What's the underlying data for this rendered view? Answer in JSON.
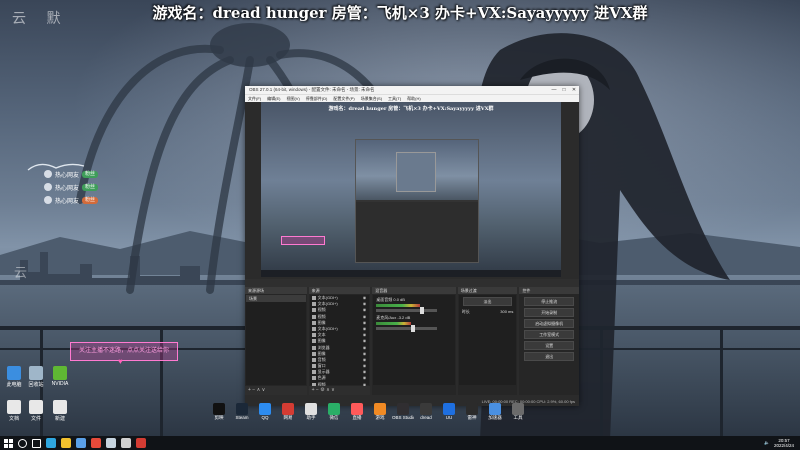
{
  "overlay": {
    "top_banner": "游戏名：dread hunger    房管：飞机×3    办卡+VX:Sayayyyyy 进VX群",
    "seal_text": "云 默",
    "seal_side": "云",
    "pink_subscribe": "关注主播不迷路，点点关注送给你",
    "chat": [
      {
        "name": "热心网友",
        "badge": "粉丝",
        "color": "#3f9e5a"
      },
      {
        "name": "热心网友",
        "badge": "粉丝",
        "color": "#3f9e5a"
      },
      {
        "name": "热心网友",
        "badge": "粉丝",
        "color": "#d36b3a"
      }
    ]
  },
  "desktop_icons": [
    {
      "label": "此电脑",
      "color": "#3b8ee0"
    },
    {
      "label": "回收站",
      "color": "#9fb6c9"
    },
    {
      "label": "NVIDIA",
      "color": "#5fb833"
    },
    {
      "label": "文档",
      "color": "#e8e8e8"
    },
    {
      "label": "文件",
      "color": "#e8e8e8"
    },
    {
      "label": "新建",
      "color": "#e8e8e8"
    }
  ],
  "obs": {
    "title": "OBS 27.0.1 (64-bit, windows) - 配置文件: 未命名 - 场景: 未命名",
    "menu": [
      "文件(F)",
      "编辑(E)",
      "视图(V)",
      "停靠部件(D)",
      "配置文件(P)",
      "场景集合(S)",
      "工具(T)",
      "帮助(H)"
    ],
    "preview_title": "游戏名：dread hunger   房管：飞机×3   办卡+VX:Sayayyyyy 进VX群",
    "window_controls": [
      "—",
      "□",
      "✕"
    ],
    "docks": {
      "scenes": {
        "header": "来源源场",
        "items": [
          "场景"
        ],
        "footer": "+ − ∧ ∨"
      },
      "sources": {
        "header": "来源",
        "items": [
          "文本(GDI+)",
          "文本(GDI+)",
          "视频",
          "视频",
          "图像",
          "文本(GDI+)",
          "文本",
          "图像",
          "浏览器",
          "图像",
          "音频",
          "窗口",
          "显示器",
          "色源",
          "视频"
        ],
        "footer": "+ − ⚙ ∧ ∨"
      },
      "mixer": {
        "header": "混音器",
        "channels": [
          {
            "name": "桌面音频 0.0 dB",
            "level": 0.72
          },
          {
            "name": "麦克风/Aux -3.2 dB",
            "level": 0.58
          }
        ]
      },
      "transitions": {
        "header": "场景过渡",
        "mode": "淡出",
        "duration_label": "时长",
        "duration": "300 ms"
      },
      "controls": {
        "header": "控件",
        "buttons": [
          "停止推流",
          "开始录制",
          "启动虚拟摄像机",
          "工作室模式",
          "设置",
          "退出"
        ]
      }
    },
    "status": "LIVE: 00:00:00   REC: 00:00:00   CPU: 2.9%, 60.00 fps"
  },
  "quick_launch": [
    {
      "label": "剪映",
      "color": "#111111"
    },
    {
      "label": "Steam",
      "color": "#1b2838"
    },
    {
      "label": "QQ",
      "color": "#2d8cf0"
    },
    {
      "label": "网易",
      "color": "#d43c33"
    },
    {
      "label": "助手",
      "color": "#e0e0e0"
    },
    {
      "label": "微信",
      "color": "#2aae67"
    },
    {
      "label": "直播",
      "color": "#ff5a5a"
    },
    {
      "label": "游戏",
      "color": "#f08a24"
    },
    {
      "label": "OBS Studio",
      "color": "#302e31"
    },
    {
      "label": "dread",
      "color": "#3a3a3a"
    },
    {
      "label": "UU",
      "color": "#1e6fe0"
    },
    {
      "label": "雷神",
      "color": "#2b2b2b"
    },
    {
      "label": "加速器",
      "color": "#4a90e2"
    },
    {
      "label": "工具",
      "color": "#6b6b6b"
    }
  ],
  "taskbar": {
    "apps": [
      {
        "name": "search",
        "color": "#ffffff"
      },
      {
        "name": "task-view",
        "color": "#ffffff"
      },
      {
        "name": "edge",
        "color": "#2fa7e0"
      },
      {
        "name": "explorer",
        "color": "#f2c12e"
      },
      {
        "name": "store",
        "color": "#5aa0e8"
      },
      {
        "name": "chrome",
        "color": "#e64a3a"
      },
      {
        "name": "steam",
        "color": "#c7d5e0"
      },
      {
        "name": "obs",
        "color": "#d0d0d0"
      },
      {
        "name": "netease",
        "color": "#d43c33"
      }
    ],
    "time": "20:57",
    "date": "2022/4/24"
  }
}
